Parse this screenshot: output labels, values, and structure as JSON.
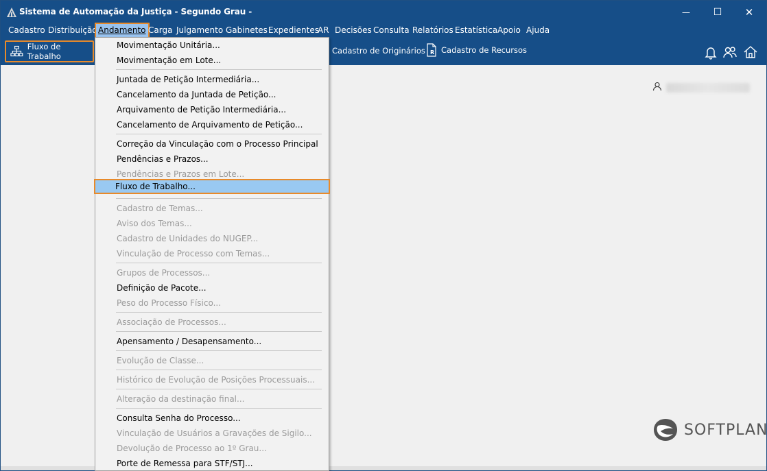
{
  "window": {
    "title": "Sistema de Automação da Justiça - Segundo Grau -"
  },
  "window_controls": {
    "minimize": "—",
    "maximize": "☐",
    "close": "✕"
  },
  "menubar": [
    {
      "label": "Cadastro"
    },
    {
      "label": "Distribuição"
    },
    {
      "label": "Andamento"
    },
    {
      "label": "Carga"
    },
    {
      "label": "Julgamento"
    },
    {
      "label": "Gabinetes"
    },
    {
      "label": "Expedientes"
    },
    {
      "label": "AR"
    },
    {
      "label": "Decisões"
    },
    {
      "label": "Consulta"
    },
    {
      "label": "Relatórios"
    },
    {
      "label": "Estatística"
    },
    {
      "label": "Apoio"
    },
    {
      "label": "Ajuda"
    }
  ],
  "toolbar": {
    "fluxo_label": "Fluxo de Trabalho",
    "cad_originarios": "Cadastro de Originários",
    "cad_recursos": "Cadastro de Recursos"
  },
  "dropdown": {
    "items": [
      {
        "label": "Movimentação Unitária...",
        "disabled": false
      },
      {
        "label": "Movimentação em Lote...",
        "disabled": false
      },
      {
        "label": "Juntada de Petição Intermediária...",
        "disabled": false
      },
      {
        "label": "Cancelamento da Juntada de Petição...",
        "disabled": false
      },
      {
        "label": "Arquivamento de Petição Intermediária...",
        "disabled": false
      },
      {
        "label": "Cancelamento de Arquivamento de Petição...",
        "disabled": false
      },
      {
        "label": "Correção da Vinculação com o Processo Principal",
        "disabled": false
      },
      {
        "label": "Pendências e Prazos...",
        "disabled": false
      },
      {
        "label": "Pendências e Prazos em Lote...",
        "disabled": true
      },
      {
        "label": "Fluxo de Trabalho...",
        "disabled": false
      },
      {
        "label": "Cadastro de Temas...",
        "disabled": true
      },
      {
        "label": "Aviso dos Temas...",
        "disabled": true
      },
      {
        "label": "Cadastro de Unidades do NUGEP...",
        "disabled": true
      },
      {
        "label": "Vinculação de Processo com Temas...",
        "disabled": true
      },
      {
        "label": "Grupos de Processos...",
        "disabled": true
      },
      {
        "label": "Definição de Pacote...",
        "disabled": false
      },
      {
        "label": "Peso do Processo Físico...",
        "disabled": true
      },
      {
        "label": "Associação de Processos...",
        "disabled": true
      },
      {
        "label": "Apensamento / Desapensamento...",
        "disabled": false
      },
      {
        "label": "Evolução de Classe...",
        "disabled": true
      },
      {
        "label": "Histórico de Evolução de Posições Processuais...",
        "disabled": true
      },
      {
        "label": "Alteração da destinação final...",
        "disabled": true
      },
      {
        "label": "Consulta Senha do Processo...",
        "disabled": false
      },
      {
        "label": "Vinculação de Usuários a Gravações de Sigilo...",
        "disabled": true
      },
      {
        "label": "Devolução de Processo ao 1º Grau...",
        "disabled": true
      },
      {
        "label": "Porte de Remessa para STF/STJ...",
        "disabled": false
      }
    ]
  },
  "brand": {
    "logo_text": "SOFTPLAN"
  },
  "colors": {
    "titlebar": "#164e88",
    "highlight": "#99c9f2",
    "callout": "#e88a2a"
  }
}
